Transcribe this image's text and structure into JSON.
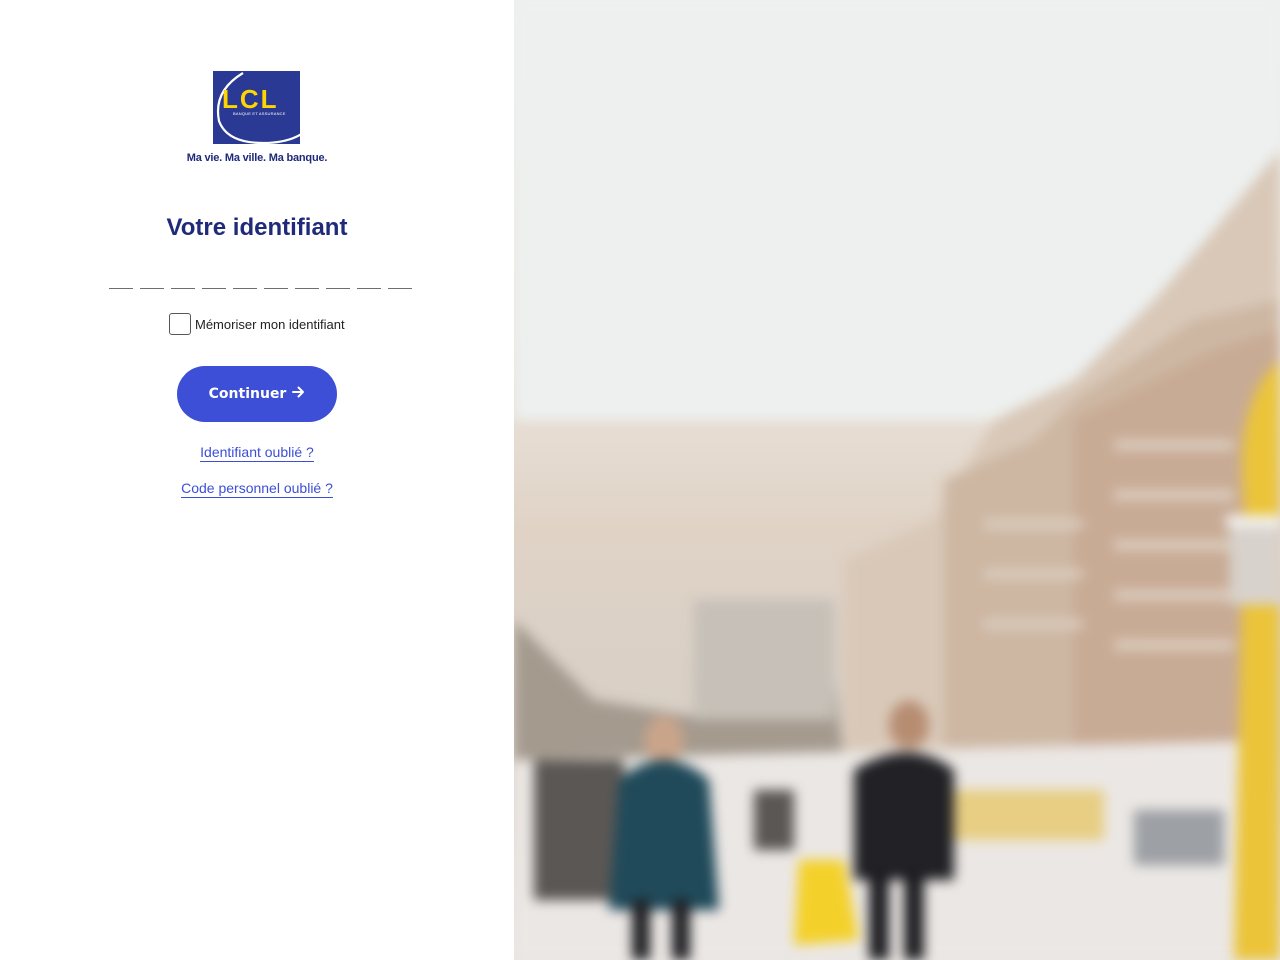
{
  "logo": {
    "brand": "LCL",
    "sub": "BANQUE ET ASSURANCE",
    "tagline": "Ma vie. Ma ville. Ma banque.",
    "colors": {
      "navy": "#2a3a94",
      "yellow": "#ffd500"
    }
  },
  "form": {
    "title": "Votre identifiant",
    "digit_count": 10,
    "remember_label": "Mémoriser mon identifiant",
    "continue_label": "Continuer",
    "continue_icon": "arrow-right-icon",
    "forgot_id_label": "Identifiant oublié ?",
    "forgot_code_label": "Code personnel oublié ?"
  },
  "theme": {
    "accent": "#3c4fd6",
    "title_color": "#1f2a7a"
  },
  "background": {
    "image_alt": "blurred city street scene"
  }
}
